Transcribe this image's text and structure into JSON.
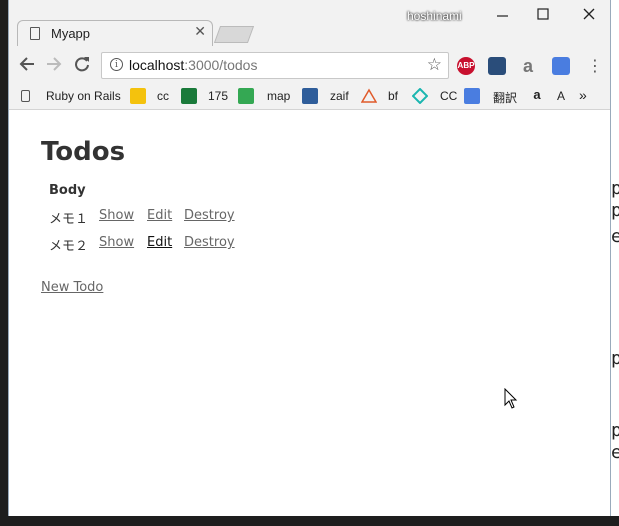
{
  "titlebar": {
    "tab_title": "Myapp",
    "username": "hoshinami"
  },
  "toolbar": {
    "url_host": "localhost",
    "url_path": ":3000/todos",
    "extensions": [
      "ABP",
      "a"
    ]
  },
  "bookmarks": [
    {
      "label": "Ruby on Rails",
      "icon": "page-icon"
    },
    {
      "label": "cc",
      "icon": "grid-icon"
    },
    {
      "label": "175",
      "icon": "u-icon"
    },
    {
      "label": "map",
      "icon": "maps-icon"
    },
    {
      "label": "zaif",
      "icon": "zaif-icon"
    },
    {
      "label": "bf",
      "icon": "triangle-icon"
    },
    {
      "label": "CC",
      "icon": "diamond-icon"
    },
    {
      "label": "翻訳",
      "icon": "translate-icon"
    },
    {
      "label": "A",
      "icon": "amazon-icon"
    }
  ],
  "page": {
    "title": "Todos",
    "column_header": "Body",
    "todos": [
      {
        "body": "メモ１",
        "show": "Show",
        "edit": "Edit",
        "destroy": "Destroy"
      },
      {
        "body": "メモ２",
        "show": "Show",
        "edit": "Edit",
        "destroy": "Destroy"
      }
    ],
    "new_link": "New Todo"
  }
}
